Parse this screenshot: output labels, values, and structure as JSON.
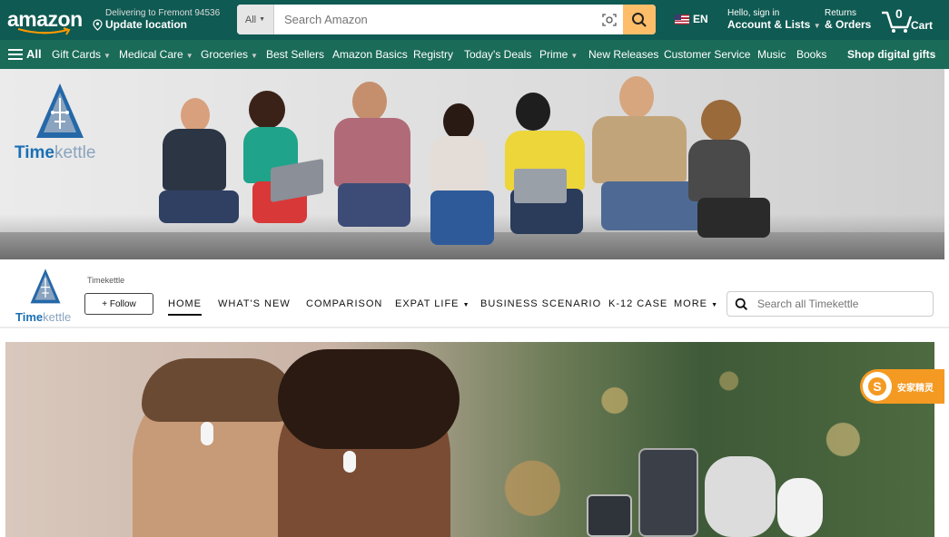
{
  "header": {
    "logo": "amazon",
    "deliver_line1": "Delivering to Fremont 94536",
    "deliver_line2": "Update location",
    "search_dept": "All",
    "search_placeholder": "Search Amazon",
    "lang": "EN",
    "account_line1": "Hello, sign in",
    "account_line2": "Account & Lists",
    "returns_line1": "Returns",
    "returns_line2": "& Orders",
    "cart_count": "0",
    "cart_label": "Cart"
  },
  "nav": {
    "all": "All",
    "items": [
      "Gift Cards",
      "Medical Care",
      "Groceries",
      "Best Sellers",
      "Amazon Basics",
      "Registry",
      "Today's Deals",
      "Prime",
      "New Releases",
      "Customer Service",
      "Music",
      "Books"
    ],
    "promo": "Shop digital gifts"
  },
  "banner": {
    "brand_prefix": "Time",
    "brand_suffix": "kettle"
  },
  "store": {
    "brand_name": "Timekettle",
    "follow_label": "+ Follow",
    "logo_prefix": "Time",
    "logo_suffix": "kettle",
    "nav": [
      "HOME",
      "WHAT'S NEW",
      "COMPARISON",
      "EXPAT LIFE",
      "BUSINESS SCENARIO",
      "K-12 CASE",
      "MORE"
    ],
    "search_placeholder": "Search all Timekettle"
  },
  "badge": {
    "text": "安家精灵"
  },
  "colors": {
    "topbar": "#0f5a52",
    "navbar": "#1a6b58",
    "search_button": "#febd69",
    "brand_blue": "#1a6fb5",
    "badge": "#f49a22"
  }
}
